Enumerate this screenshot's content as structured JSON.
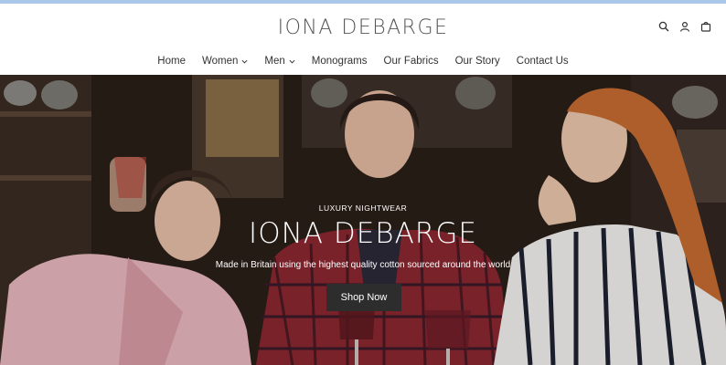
{
  "brand": {
    "logo_text": "IONA DEBARGE"
  },
  "utility": [
    {
      "name": "search-icon"
    },
    {
      "name": "account-icon"
    },
    {
      "name": "cart-icon"
    }
  ],
  "nav": [
    {
      "label": "Home",
      "dropdown": false
    },
    {
      "label": "Women",
      "dropdown": true
    },
    {
      "label": "Men",
      "dropdown": true
    },
    {
      "label": "Monograms",
      "dropdown": false
    },
    {
      "label": "Our Fabrics",
      "dropdown": false
    },
    {
      "label": "Our Story",
      "dropdown": false
    },
    {
      "label": "Contact Us",
      "dropdown": false
    }
  ],
  "hero": {
    "eyebrow": "LUXURY NIGHTWEAR",
    "headline": "IONA DEBARGE",
    "tagline": "Made in Britain using the highest quality cotton sourced around the world",
    "cta_label": "Shop Now"
  },
  "colors": {
    "accent_bar": "#a9c8ea",
    "cta_background": "#2d2d2d"
  }
}
